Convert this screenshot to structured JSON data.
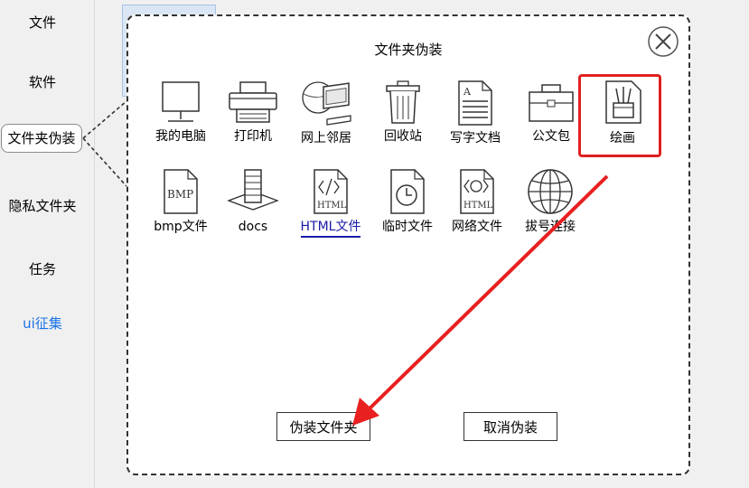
{
  "sidebar": {
    "items": [
      {
        "label": "文件"
      },
      {
        "label": "软件"
      },
      {
        "label": "文件夹伪装"
      },
      {
        "label": "隐私文件夹"
      },
      {
        "label": "任务"
      },
      {
        "label": "ui征集"
      }
    ]
  },
  "dialog": {
    "title": "文件夹伪装",
    "icons": [
      {
        "label": "我的电脑",
        "icon": "computer-icon"
      },
      {
        "label": "打印机",
        "icon": "printer-icon"
      },
      {
        "label": "网上邻居",
        "icon": "network-places-icon"
      },
      {
        "label": "回收站",
        "icon": "recycle-bin-icon"
      },
      {
        "label": "写字文档",
        "icon": "text-document-icon"
      },
      {
        "label": "公文包",
        "icon": "briefcase-icon"
      },
      {
        "label": "绘画",
        "icon": "paint-icon"
      },
      {
        "label": "bmp文件",
        "icon": "bmp-file-icon",
        "text": "BMP"
      },
      {
        "label": "docs",
        "icon": "docs-icon"
      },
      {
        "label": "HTML文件",
        "icon": "html-file-icon",
        "text": "HTML"
      },
      {
        "label": "临时文件",
        "icon": "temp-file-icon"
      },
      {
        "label": "网络文件",
        "icon": "network-file-icon",
        "text": "HTML"
      },
      {
        "label": "拔号连接",
        "icon": "dialup-icon"
      }
    ],
    "confirm_label": "伪装文件夹",
    "cancel_label": "取消伪装",
    "highlight_color": "#e02020"
  }
}
